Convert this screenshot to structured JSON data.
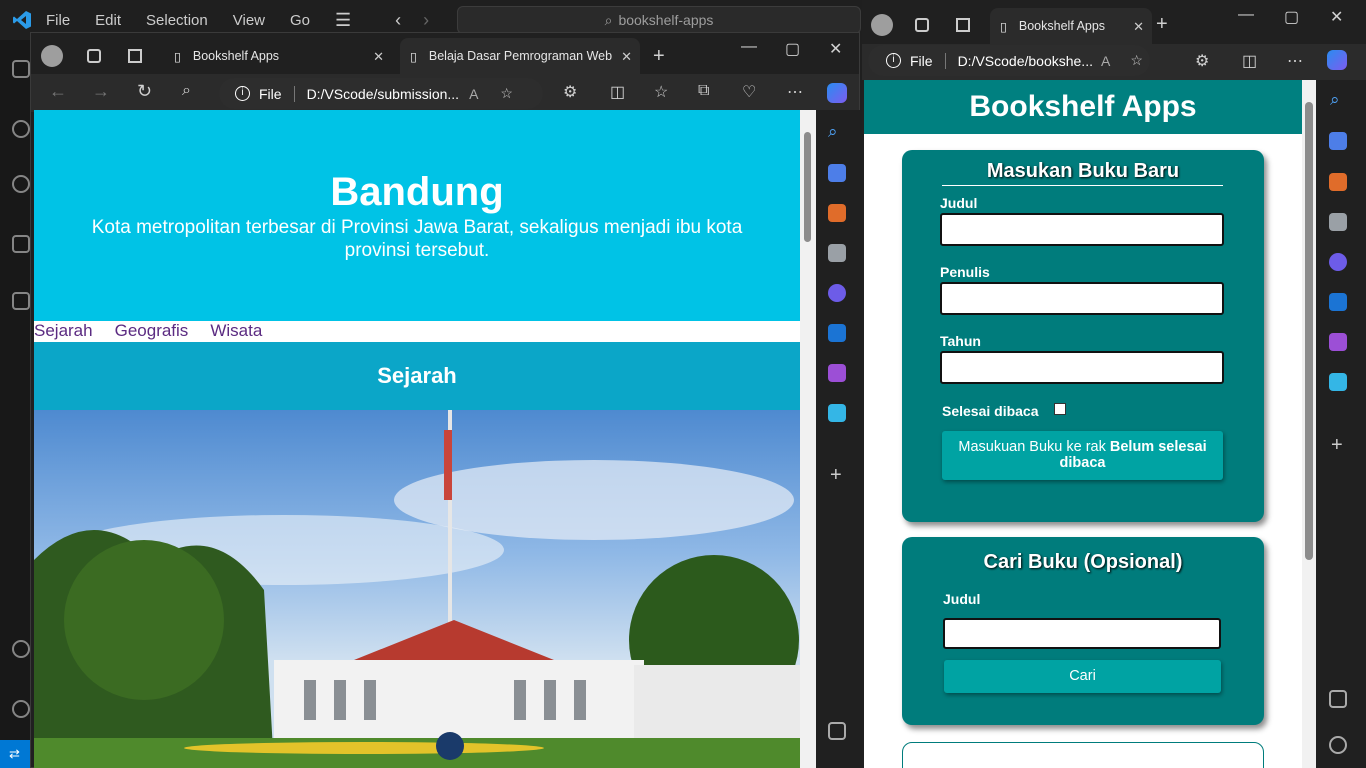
{
  "vscode": {
    "menu": [
      "File",
      "Edit",
      "Selection",
      "View",
      "Go"
    ],
    "search": "bookshelf-apps"
  },
  "left_browser": {
    "tabs": [
      {
        "label": "Bookshelf Apps"
      },
      {
        "label": "Belaja Dasar Pemrograman Web"
      }
    ],
    "address": {
      "scheme": "File",
      "url": "D:/VScode/submission..."
    },
    "page": {
      "title": "Bandung",
      "subtitle": "Kota metropolitan terbesar di Provinsi Jawa Barat, sekaligus menjadi ibu kota provinsi tersebut.",
      "nav": [
        "Sejarah",
        "Geografis",
        "Wisata"
      ],
      "section_title": "Sejarah"
    }
  },
  "right_browser": {
    "tab": "Bookshelf Apps",
    "address": {
      "scheme": "File",
      "url": "D:/VScode/bookshe..."
    },
    "page": {
      "header": "Bookshelf Apps",
      "form": {
        "title": "Masukan Buku Baru",
        "judul": "Judul",
        "penulis": "Penulis",
        "tahun": "Tahun",
        "done_label": "Selesai dibaca",
        "submit_prefix": "Masukuan Buku ke rak ",
        "submit_bold": "Belum selesai dibaca"
      },
      "search": {
        "title": "Cari Buku (Opsional)",
        "judul": "Judul",
        "button": "Cari"
      }
    }
  },
  "colors": {
    "hero": "#00c3e6",
    "section": "#0ba6c8",
    "teal": "#007c7c",
    "button": "#00a3a3"
  }
}
